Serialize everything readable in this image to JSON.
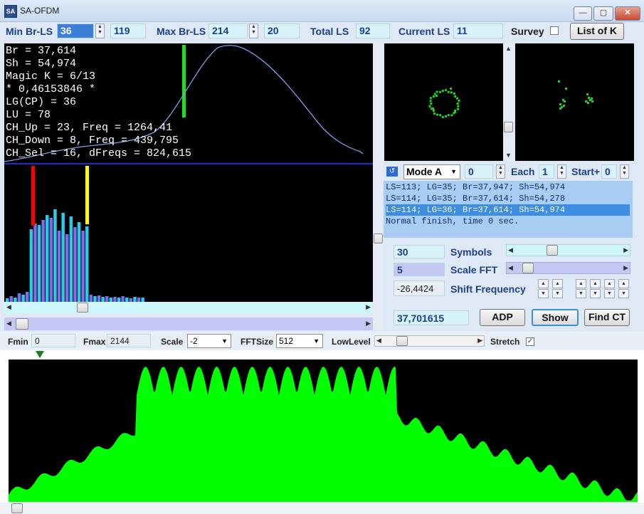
{
  "window": {
    "title": "SA-OFDM",
    "icon_text": "SA",
    "min": "—",
    "max": "▢",
    "close": "✕"
  },
  "top": {
    "min_br_ls_label": "Min Br-LS",
    "min_br_ls_value": "36",
    "min_br_ls_aux": "119",
    "max_br_ls_label": "Max Br-LS",
    "max_br_ls_value": "214",
    "max_br_ls_aux": "20",
    "total_ls_label": "Total LS",
    "total_ls_value": "92",
    "current_ls_label": "Current LS",
    "current_ls_value": "11",
    "survey_label": "Survey",
    "list_of_k_label": "List of K"
  },
  "info": {
    "lines": [
      "Br = 37,614",
      "Sh = 54,974",
      "Magic K = 6/13",
      "* 0,46153846 *",
      "LG(CP) = 36",
      "LU = 78",
      "CH_Up = 23, Freq = 1264,41",
      "CH_Down = 8, Freq = 439,795",
      "CH_Sel = 16, dFreqs = 824,615"
    ]
  },
  "mode": {
    "mode_value": "Mode A",
    "mode_num": "0",
    "each_label": "Each",
    "each_value": "1",
    "start_label": "Start+",
    "start_value": "0"
  },
  "log": {
    "lines": [
      "LS=113; LG=35; Br=37,947; Sh=54,974",
      "LS=114; LG=35; Br=37,614; Sh=54,278",
      "LS=114; LG=36; Br=37,614; Sh=54,974",
      "Normal finish, time 0 sec."
    ],
    "selected_index": 2
  },
  "controls": {
    "symbols_value": "30",
    "symbols_label": "Symbols",
    "scale_fft_value": "5",
    "scale_fft_label": "Scale FFT",
    "shift_value": "-26,4424",
    "shift_label": "Shift Frequency",
    "result_value": "37,701615",
    "adp_label": "ADP",
    "show_label": "Show",
    "find_ct_label": "Find CT"
  },
  "bottom_bar": {
    "fmin_label": "Fmin",
    "fmin_value": "0",
    "fmax_label": "Fmax",
    "fmax_value": "2144",
    "scale_label": "Scale",
    "scale_value": "-2",
    "fftsize_label": "FFTSize",
    "fftsize_value": "512",
    "lowlevel_label": "LowLevel",
    "stretch_label": "Stretch"
  },
  "colors": {
    "green": "#00ff00",
    "blue_curve": "#6b8fe0",
    "cyan_bar": "#29c9e8",
    "purple_bar": "#7b6cf0",
    "red_marker": "#ff0000",
    "yellow_marker": "#ffff00"
  }
}
